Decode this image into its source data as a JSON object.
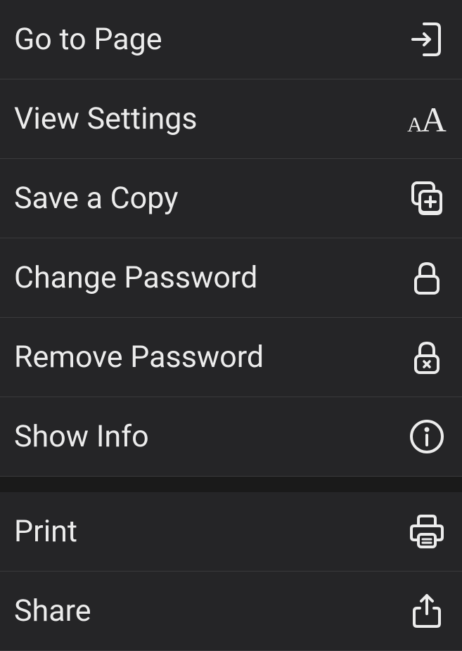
{
  "menu": {
    "section1": [
      {
        "label": "Go to Page",
        "icon": "enter-page-icon",
        "name": "go-to-page-item"
      },
      {
        "label": "View Settings",
        "icon": "text-size-icon",
        "name": "view-settings-item"
      },
      {
        "label": "Save a Copy",
        "icon": "copy-plus-icon",
        "name": "save-a-copy-item"
      },
      {
        "label": "Change Password",
        "icon": "lock-icon",
        "name": "change-password-item"
      },
      {
        "label": "Remove Password",
        "icon": "lock-x-icon",
        "name": "remove-password-item"
      },
      {
        "label": "Show Info",
        "icon": "info-icon",
        "name": "show-info-item"
      }
    ],
    "section2": [
      {
        "label": "Print",
        "icon": "printer-icon",
        "name": "print-item"
      },
      {
        "label": "Share",
        "icon": "share-icon",
        "name": "share-item"
      }
    ]
  },
  "colors": {
    "background": "#1a1a1a",
    "item_background": "#252527",
    "text": "#ececec",
    "divider": "#3a3a3c"
  }
}
